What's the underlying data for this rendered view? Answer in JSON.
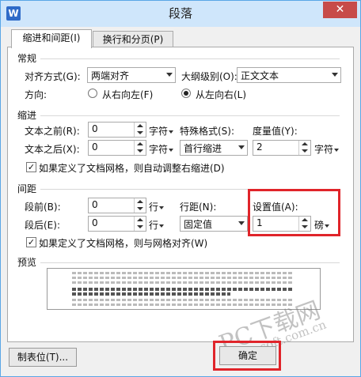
{
  "window": {
    "title": "段落",
    "app_icon": "W",
    "close": "✕"
  },
  "tabs": [
    {
      "label": "缩进和间距(I)",
      "active": true
    },
    {
      "label": "换行和分页(P)",
      "active": false
    }
  ],
  "general": {
    "section": "常规",
    "alignment_label": "对齐方式(G):",
    "alignment_value": "两端对齐",
    "outline_label": "大纲级别(O):",
    "outline_value": "正文文本",
    "direction_label": "方向:",
    "rtl_label": "从右向左(F)",
    "ltr_label": "从左向右(L)"
  },
  "indent": {
    "section": "缩进",
    "before_label": "文本之前(R):",
    "before_value": "0",
    "before_unit": "字符",
    "after_label": "文本之后(X):",
    "after_value": "0",
    "after_unit": "字符",
    "special_label": "特殊格式(S):",
    "special_value": "首行缩进",
    "measure_label": "度量值(Y):",
    "measure_value": "2",
    "measure_unit": "字符",
    "grid_check_label": "如果定义了文档网格，则自动调整右缩进(D)"
  },
  "spacing": {
    "section": "间距",
    "before_label": "段前(B):",
    "before_value": "0",
    "before_unit": "行",
    "after_label": "段后(E):",
    "after_value": "0",
    "after_unit": "行",
    "line_label": "行距(N):",
    "line_value": "固定值",
    "set_label": "设置值(A):",
    "set_value": "1",
    "set_unit": "磅",
    "grid_check_label": "如果定义了文档网格，则与网格对齐(W)"
  },
  "preview": {
    "section": "预览"
  },
  "buttons": {
    "tabs": "制表位(T)...",
    "ok": "确定"
  },
  "watermark": {
    "brand": "PC下载网",
    "url": "pcsoft.com.cn"
  },
  "colors": {
    "accent": "#5aa6e6",
    "highlight": "#e0242a",
    "close": "#c74b49"
  }
}
